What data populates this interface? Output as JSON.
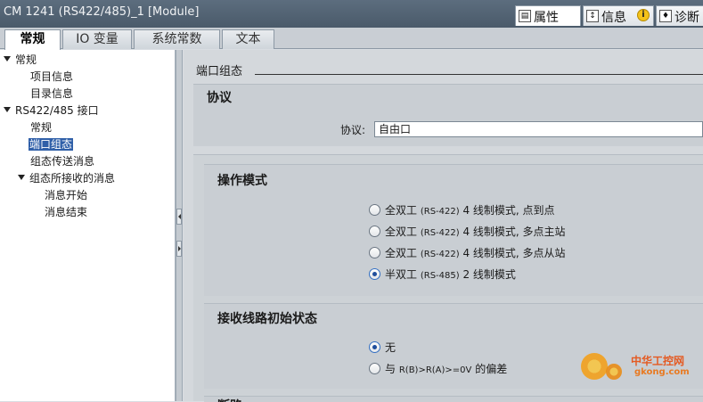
{
  "window": {
    "title": "CM 1241 (RS422/485)_1 [Module]",
    "right_tabs": [
      {
        "label": "属性",
        "icon": "properties-icon"
      },
      {
        "label": "信息",
        "icon": "info-icon"
      },
      {
        "label": "诊断",
        "icon": "diagnostics-icon"
      }
    ]
  },
  "tabs": [
    "常规",
    "IO 变量",
    "系统常数",
    "文本"
  ],
  "tree": [
    {
      "label": "常规"
    },
    {
      "label": "项目信息"
    },
    {
      "label": "目录信息"
    },
    {
      "label": "RS422/485 接口"
    },
    {
      "label": "常规"
    },
    {
      "label": "端口组态"
    },
    {
      "label": "组态传送消息"
    },
    {
      "label": "组态所接收的消息"
    },
    {
      "label": "消息开始"
    },
    {
      "label": "消息结束"
    }
  ],
  "content": {
    "section_title": "端口组态",
    "protocol": {
      "heading": "协议",
      "label": "协议:",
      "value": "自由口"
    },
    "operating_mode": {
      "heading": "操作模式",
      "options": [
        {
          "main": "全双工",
          "paren": "(RS-422)",
          "rest": "4 线制模式, 点到点",
          "selected": false
        },
        {
          "main": "全双工",
          "paren": "(RS-422)",
          "rest": "4 线制模式, 多点主站",
          "selected": false
        },
        {
          "main": "全双工",
          "paren": "(RS-422)",
          "rest": "4 线制模式, 多点从站",
          "selected": false
        },
        {
          "main": "半双工",
          "paren": "(RS-485)",
          "rest": "2 线制模式",
          "selected": true
        }
      ]
    },
    "receive_line": {
      "heading": "接收线路初始状态",
      "options": [
        {
          "main": "无",
          "paren": "",
          "rest": "",
          "selected": true
        },
        {
          "main": "与",
          "paren": "R(B)>R(A)>=0V",
          "rest": "的偏差",
          "selected": false
        }
      ]
    },
    "next_heading": "断路"
  },
  "watermark": {
    "cn": "中华工控网",
    "en": "gkong.com"
  }
}
